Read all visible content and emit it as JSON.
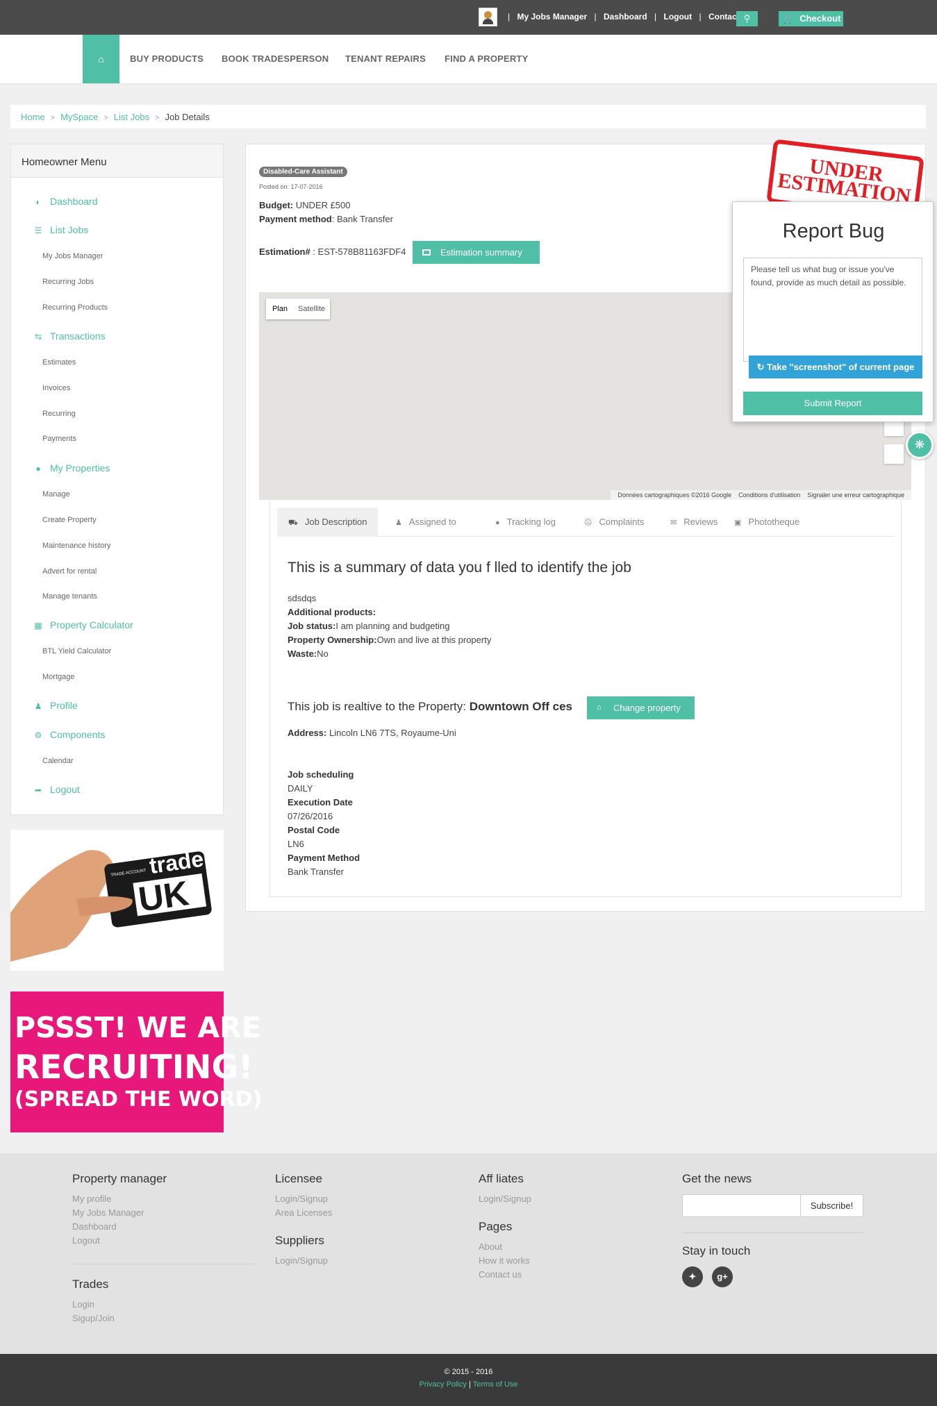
{
  "topbar": {
    "links": [
      "My Jobs Manager",
      "Dashboard",
      "Logout",
      "Contact"
    ],
    "checkout": "Checkout"
  },
  "nav": {
    "items": [
      "BUY PRODUCTS",
      "BOOK TRADESPERSON",
      "TENANT REPAIRS",
      "FIND A PROPERTY"
    ]
  },
  "breadcrumb": [
    "Home",
    "MySpace",
    "List Jobs",
    "Job Details"
  ],
  "sidebar": {
    "title": "Homeowner Menu",
    "dashboard": "Dashboard",
    "list_jobs": "List Jobs",
    "my_jobs_manager": "My Jobs Manager",
    "recurring_jobs": "Recurring Jobs",
    "recurring_products": "Recurring Products",
    "transactions": "Transactions",
    "estimates": "Estimates",
    "invoices": "Invoices",
    "recurring": "Recurring",
    "payments": "Payments",
    "my_properties": "My Properties",
    "manage": "Manage",
    "create_property": "Create Property",
    "maintenance_history": "Maintenance history",
    "advert_for_rental": "Advert for rental",
    "manage_tenants": "Manage tenants",
    "property_calculator": "Property Calculator",
    "btl_yield": "BTL Yield Calculator",
    "mortgage": "Mortgage",
    "profile": "Profile",
    "components": "Components",
    "calendar": "Calendar",
    "logout": "Logout"
  },
  "ads": {
    "card_text_small": "TRADE ACCOUNT",
    "card_text_big": "trade",
    "card_text_uk": "UK",
    "recruit_line1": "PSSST! WE ARE",
    "recruit_line2": "RECRUITING!",
    "recruit_line3": "(SPREAD THE WORD)"
  },
  "job": {
    "stamp_line1": "UNDER",
    "stamp_line2": "ESTIMATION",
    "category": "Disabled-Care Assistant",
    "posted": "Posted on: 17-07-2016",
    "budget_label": "Budget:",
    "budget_value": "UNDER £500",
    "payment_label": "Payment method",
    "payment_value": ": Bank Transfer",
    "estimation_label": "Estimation#",
    "estimation_value": " : EST-578B81163FDF4",
    "estimation_button": "Estimation summary"
  },
  "map": {
    "plan": "Plan",
    "satellite": "Satellite",
    "footer": [
      "Données cartographiques ©2016 Google",
      "Conditions d'utilisation",
      "Signaler une erreur cartographique"
    ]
  },
  "tabs": [
    "Job Description",
    "Assigned to",
    "Tracking log",
    "Complaints",
    "Reviews",
    "Phototheque"
  ],
  "description": {
    "title": "This is a summary of data you f lled to identify the job",
    "text": "sdsdqs",
    "additional_label": "Additional products:",
    "status_label": "Job status:",
    "status_value": "I am planning and budgeting",
    "ownership_label": "Property Ownership:",
    "ownership_value": "Own and live at this property",
    "waste_label": "Waste:",
    "waste_value": "No",
    "property_prefix": "This job is realtive to the Property: ",
    "property_name": "Downtown Off ces",
    "change_button": "Change property",
    "address_label": "Address:",
    "address_value": " Lincoln LN6 7TS, Royaume-Uni",
    "scheduling_label": "Job scheduling",
    "scheduling_value": "DAILY",
    "execution_label": "Execution Date",
    "execution_value": "07/26/2016",
    "postal_label": "Postal Code",
    "postal_value": "LN6",
    "payment_label": "Payment Method",
    "payment_value": "Bank Transfer"
  },
  "report_bug": {
    "title": "Report Bug",
    "placeholder": "Please tell us what bug or issue you've found, provide as much detail as possible.",
    "screenshot_button": "Take \"screenshot\" of current page",
    "submit": "Submit Report"
  },
  "footer": {
    "property_manager": "Property manager",
    "pm_links": [
      "My profile",
      "My Jobs Manager",
      "Dashboard",
      "Logout"
    ],
    "trades": "Trades",
    "trades_links": [
      "Login",
      "Sigup/Join"
    ],
    "licensee": "Licensee",
    "licensee_links": [
      "Login/Signup",
      "Area Licenses"
    ],
    "suppliers": "Suppliers",
    "suppliers_links": [
      "Login/Signup"
    ],
    "affiliates": "Aff liates",
    "affiliates_links": [
      "Login/Signup"
    ],
    "pages": "Pages",
    "pages_links": [
      "About",
      "How it works",
      "Contact us"
    ],
    "news": "Get the news",
    "subscribe": "Subscribe!",
    "stay": "Stay in touch",
    "copyright": "© 2015 - 2016",
    "privacy": "Privacy Policy",
    "terms": "Terms of Use"
  }
}
